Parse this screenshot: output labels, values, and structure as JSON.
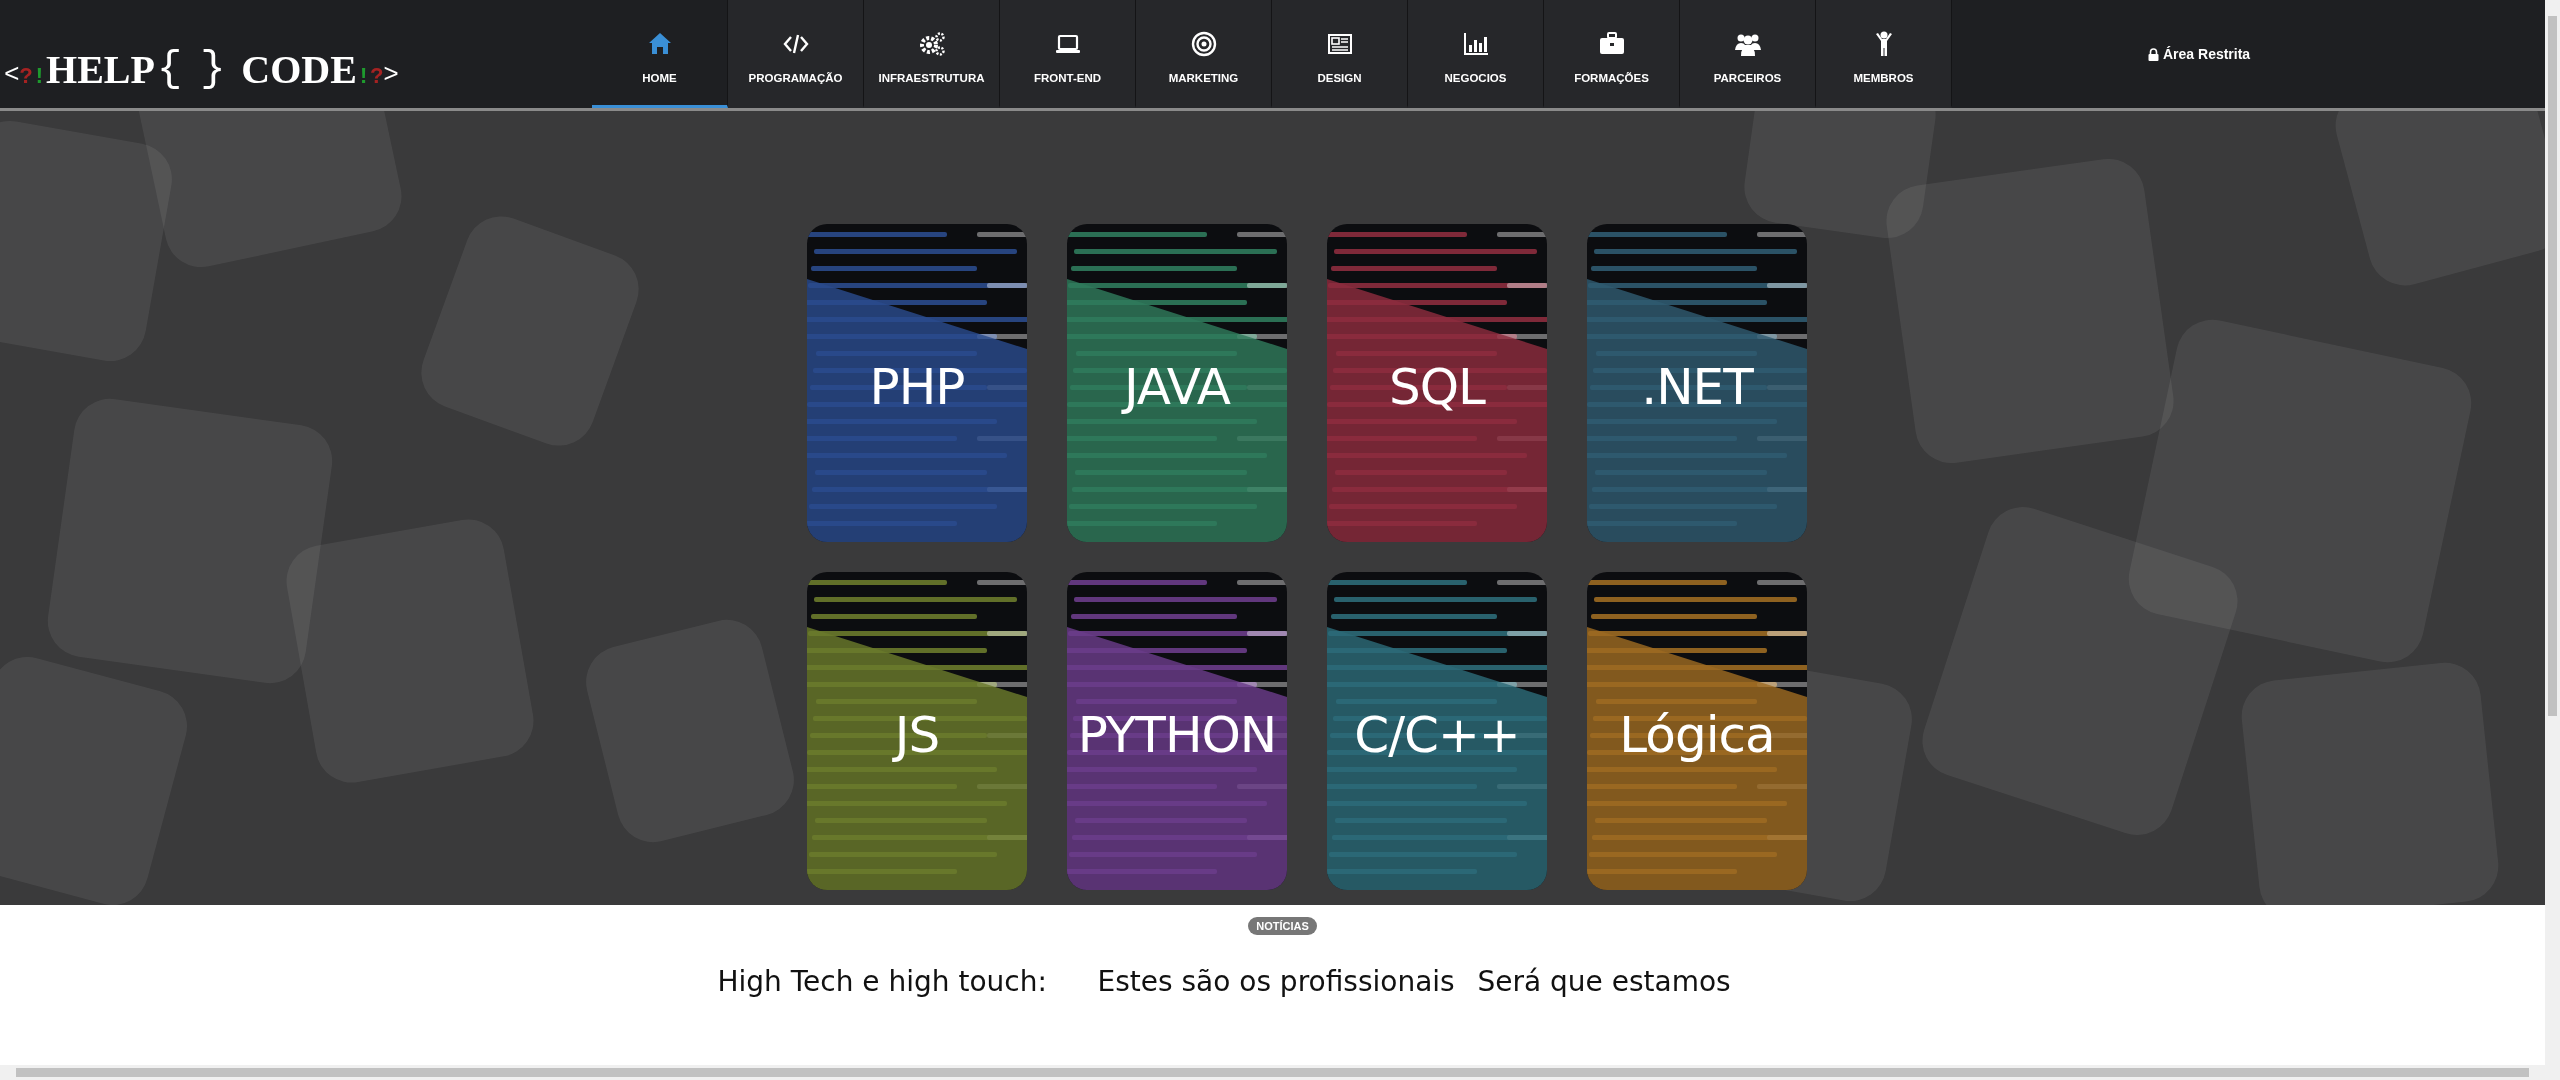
{
  "logo": {
    "parts": [
      {
        "text": "<",
        "kind": "bracket"
      },
      {
        "text": "?",
        "kind": "question"
      },
      {
        "text": "!",
        "kind": "bang"
      },
      {
        "text": "HELP",
        "kind": "word"
      },
      {
        "text": "{",
        "kind": "brace"
      },
      {
        "text": "}",
        "kind": "brace"
      },
      {
        "text": "CODE",
        "kind": "word"
      },
      {
        "text": "!",
        "kind": "bang"
      },
      {
        "text": "?",
        "kind": "question"
      },
      {
        "text": ">",
        "kind": "bracket"
      }
    ]
  },
  "nav": {
    "items": [
      {
        "label": "HOME",
        "selected": true
      },
      {
        "label": "PROGRAMAÇÃO",
        "selected": false
      },
      {
        "label": "INFRAESTRUTURA",
        "selected": false
      },
      {
        "label": "FRONT-END",
        "selected": false
      },
      {
        "label": "MARKETING",
        "selected": false
      },
      {
        "label": "DESIGN",
        "selected": false
      },
      {
        "label": "NEGOCIOS",
        "selected": false
      },
      {
        "label": "FORMAÇÕES",
        "selected": false
      },
      {
        "label": "PARCEIROS",
        "selected": false
      },
      {
        "label": "MEMBROS",
        "selected": false
      }
    ],
    "restricted": "Área Restrita"
  },
  "categories": [
    {
      "label": "PHP",
      "color": "#2a4a8c"
    },
    {
      "label": "JAVA",
      "color": "#2f7a5c"
    },
    {
      "label": "SQL",
      "color": "#8c2c3e"
    },
    {
      "label": ".NET",
      "color": "#2f5a70"
    },
    {
      "label": "JS",
      "color": "#6a7a2c"
    },
    {
      "label": "PYTHON",
      "color": "#6a3c8a"
    },
    {
      "label": "C/C++",
      "color": "#2c6a78"
    },
    {
      "label": "Lógica",
      "color": "#9c6a22"
    }
  ],
  "news": {
    "badge": "NOTÍCIAS",
    "items": [
      {
        "title": "High Tech e high touch:"
      },
      {
        "title": "Estes são os profissionais"
      },
      {
        "title": "Será que estamos"
      }
    ]
  }
}
